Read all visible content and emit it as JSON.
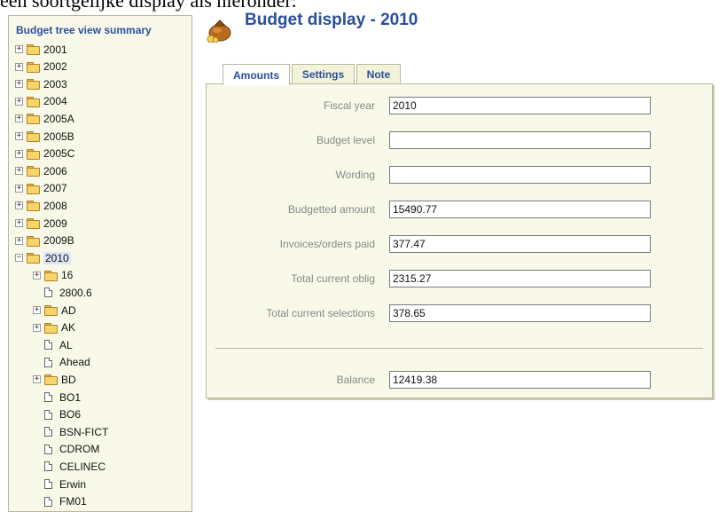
{
  "caption": "een soortgelijke display als hieronder:",
  "sidebar": {
    "title": "Budget tree view summary",
    "items": [
      {
        "label": "2001",
        "type": "folder",
        "expander": "+",
        "level": 0
      },
      {
        "label": "2002",
        "type": "folder",
        "expander": "+",
        "level": 0
      },
      {
        "label": "2003",
        "type": "folder",
        "expander": "+",
        "level": 0
      },
      {
        "label": "2004",
        "type": "folder",
        "expander": "+",
        "level": 0
      },
      {
        "label": "2005A",
        "type": "folder",
        "expander": "+",
        "level": 0
      },
      {
        "label": "2005B",
        "type": "folder",
        "expander": "+",
        "level": 0
      },
      {
        "label": "2005C",
        "type": "folder",
        "expander": "+",
        "level": 0
      },
      {
        "label": "2006",
        "type": "folder",
        "expander": "+",
        "level": 0
      },
      {
        "label": "2007",
        "type": "folder",
        "expander": "+",
        "level": 0
      },
      {
        "label": "2008",
        "type": "folder",
        "expander": "+",
        "level": 0
      },
      {
        "label": "2009",
        "type": "folder",
        "expander": "+",
        "level": 0
      },
      {
        "label": "2009B",
        "type": "folder",
        "expander": "+",
        "level": 0
      },
      {
        "label": "2010",
        "type": "folder",
        "expander": "−",
        "level": 0,
        "selected": true
      },
      {
        "label": "16",
        "type": "folder",
        "expander": "+",
        "level": 1
      },
      {
        "label": "2800.6",
        "type": "page",
        "level": 1
      },
      {
        "label": "AD",
        "type": "folder",
        "expander": "+",
        "level": 1
      },
      {
        "label": "AK",
        "type": "folder",
        "expander": "+",
        "level": 1
      },
      {
        "label": "AL",
        "type": "page",
        "level": 1
      },
      {
        "label": "Ahead",
        "type": "page",
        "level": 1
      },
      {
        "label": "BD",
        "type": "folder",
        "expander": "+",
        "level": 1
      },
      {
        "label": "BO1",
        "type": "page",
        "level": 1
      },
      {
        "label": "BO6",
        "type": "page",
        "level": 1
      },
      {
        "label": "BSN-FICT",
        "type": "page",
        "level": 1
      },
      {
        "label": "CDROM",
        "type": "page",
        "level": 1
      },
      {
        "label": "CELINEC",
        "type": "page",
        "level": 1
      },
      {
        "label": "Erwin",
        "type": "page",
        "level": 1
      },
      {
        "label": "FM01",
        "type": "page",
        "level": 1
      }
    ]
  },
  "header": {
    "title": "Budget display - 2010"
  },
  "tabs": [
    {
      "label": "Amounts",
      "active": true
    },
    {
      "label": "Settings",
      "active": false
    },
    {
      "label": "Note",
      "active": false
    }
  ],
  "fields": [
    {
      "label": "Fiscal year",
      "value": "2010"
    },
    {
      "label": "Budget level",
      "value": ""
    },
    {
      "label": "Wording",
      "value": ""
    },
    {
      "label": "Budgetted amount",
      "value": "15490.77"
    },
    {
      "label": "Invoices/orders paid",
      "value": "377.47"
    },
    {
      "label": "Total current oblig",
      "value": "2315.27"
    },
    {
      "label": "Total current selections",
      "value": "378.65"
    }
  ],
  "balance": {
    "label": "Balance",
    "value": "12419.38"
  }
}
